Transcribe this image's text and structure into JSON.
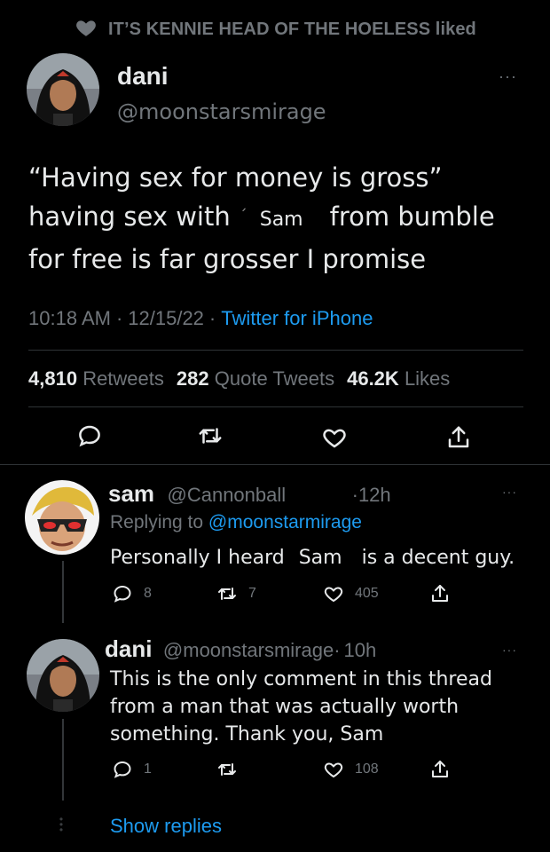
{
  "social_context": {
    "text": "IT’S KENNIE HEAD OF THE HOELESS liked",
    "icon": "heart-icon"
  },
  "main_tweet": {
    "name": "dani",
    "handle": "@moonstarsmirage",
    "text_line1": "“Having sex for money is gross”",
    "text_line2_a": "having sex with",
    "text_mark": "´",
    "text_sam": "Sam",
    "text_line2_b": "from bumble",
    "text_line3": "for free is far grosser I promise",
    "time": "10:18 AM",
    "date": "12/15/22",
    "source": "Twitter for iPhone",
    "retweets_count": "4,810",
    "retweets_label": "Retweets",
    "quotes_count": "282",
    "quotes_label": "Quote Tweets",
    "likes_count": "46.2K",
    "likes_label": "Likes"
  },
  "reply1": {
    "name": "sam",
    "handle": "@Cannonball",
    "time": "12h",
    "replying_label": "Replying to",
    "replying_to": "@moonstarmirage",
    "text_a": "Personally I heard",
    "text_sam": "Sam",
    "text_b": "is a decent guy.",
    "replies": "8",
    "retweets": "7",
    "likes": "405"
  },
  "reply2": {
    "name": "dani",
    "handle": "@moonstarsmirage",
    "time": "10h",
    "text_line1": "This is the only comment in this thread",
    "text_line2": "from a man that was actually worth",
    "text_line3": "something. Thank you, Sam",
    "replies": "1",
    "likes": "108"
  },
  "show_replies": "Show replies",
  "separator_dot": "·",
  "more_glyph": "···",
  "colors": {
    "background": "#000000",
    "text": "#e7e9ea",
    "muted": "#71767b",
    "link": "#1d9bf0",
    "divider": "#2f3336"
  }
}
